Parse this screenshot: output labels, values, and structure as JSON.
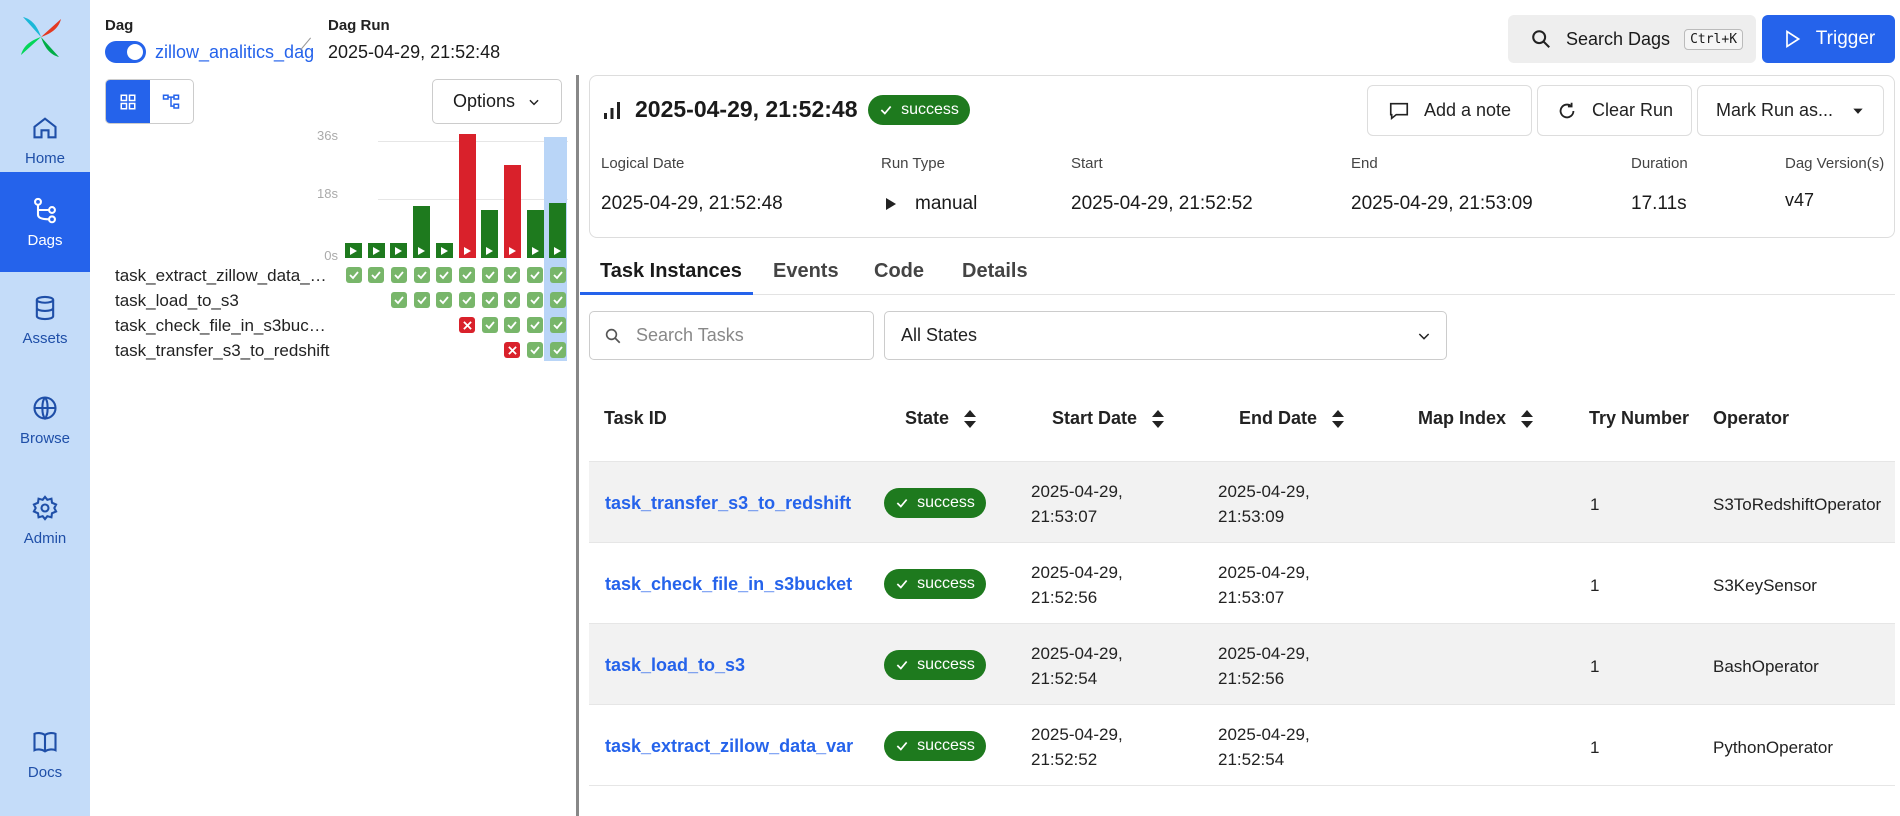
{
  "sidebar": {
    "items": [
      {
        "label": "Home",
        "icon": "home-icon"
      },
      {
        "label": "Dags",
        "icon": "dags-icon"
      },
      {
        "label": "Assets",
        "icon": "database-icon"
      },
      {
        "label": "Browse",
        "icon": "globe-icon"
      },
      {
        "label": "Admin",
        "icon": "gear-icon"
      },
      {
        "label": "Docs",
        "icon": "book-icon"
      }
    ],
    "active": "Dags"
  },
  "header": {
    "dag_label": "Dag",
    "dag_name": "zillow_analitics_dag",
    "run_label": "Dag Run",
    "run_value": "2025-04-29, 21:52:48",
    "search_label": "Search Dags",
    "search_shortcut": "Ctrl+K",
    "trigger_label": "Trigger"
  },
  "grid": {
    "options_label": "Options",
    "axis": [
      "36s",
      "18s",
      "0s"
    ],
    "durations_s": [
      4,
      4,
      4,
      15,
      4,
      36,
      14,
      27,
      14,
      16
    ],
    "run_states": [
      "success",
      "success",
      "success",
      "success",
      "success",
      "failed",
      "success",
      "failed",
      "success",
      "success"
    ],
    "tasks": [
      {
        "name": "task_extract_zillow_data_v...",
        "states": [
          "success",
          "success",
          "success",
          "success",
          "success",
          "success",
          "success",
          "success",
          "success",
          "success"
        ]
      },
      {
        "name": "task_load_to_s3",
        "states": [
          "none",
          "none",
          "success",
          "success",
          "success",
          "success",
          "success",
          "success",
          "success",
          "success"
        ]
      },
      {
        "name": "task_check_file_in_s3bucket",
        "states": [
          "none",
          "none",
          "none",
          "none",
          "none",
          "failed",
          "success",
          "success",
          "success",
          "success"
        ]
      },
      {
        "name": "task_transfer_s3_to_redshift",
        "states": [
          "none",
          "none",
          "none",
          "none",
          "none",
          "none",
          "none",
          "failed",
          "success",
          "success"
        ]
      }
    ]
  },
  "run": {
    "title": "2025-04-29, 21:52:48",
    "state": "success",
    "actions": {
      "note": "Add a note",
      "clear": "Clear Run",
      "mark": "Mark Run as..."
    },
    "meta": {
      "logical_date_label": "Logical Date",
      "logical_date": "2025-04-29, 21:52:48",
      "run_type_label": "Run Type",
      "run_type": "manual",
      "start_label": "Start",
      "start": "2025-04-29, 21:52:52",
      "end_label": "End",
      "end": "2025-04-29, 21:53:09",
      "duration_label": "Duration",
      "duration": "17.11s",
      "version_label": "Dag Version(s)",
      "version": "v47"
    }
  },
  "tabs": [
    "Task Instances",
    "Events",
    "Code",
    "Details"
  ],
  "filters": {
    "search_placeholder": "Search Tasks",
    "state_value": "All States"
  },
  "table": {
    "headers": {
      "task_id": "Task ID",
      "state": "State",
      "start": "Start Date",
      "end": "End Date",
      "map_index": "Map Index",
      "try": "Try Number",
      "operator": "Operator"
    },
    "rows": [
      {
        "task_id": "task_transfer_s3_to_redshift",
        "state": "success",
        "start_d": "2025-04-29,",
        "start_t": "21:53:07",
        "end_d": "2025-04-29,",
        "end_t": "21:53:09",
        "try": "1",
        "operator": "S3ToRedshiftOperator"
      },
      {
        "task_id": "task_check_file_in_s3bucket",
        "state": "success",
        "start_d": "2025-04-29,",
        "start_t": "21:52:56",
        "end_d": "2025-04-29,",
        "end_t": "21:53:07",
        "try": "1",
        "operator": "S3KeySensor"
      },
      {
        "task_id": "task_load_to_s3",
        "state": "success",
        "start_d": "2025-04-29,",
        "start_t": "21:52:54",
        "end_d": "2025-04-29,",
        "end_t": "21:52:56",
        "try": "1",
        "operator": "BashOperator"
      },
      {
        "task_id": "task_extract_zillow_data_var",
        "state": "success",
        "start_d": "2025-04-29,",
        "start_t": "21:52:52",
        "end_d": "2025-04-29,",
        "end_t": "21:52:54",
        "try": "1",
        "operator": "PythonOperator"
      }
    ]
  },
  "colors": {
    "accent": "#2563eb",
    "success": "#1e7a1e",
    "failed": "#d9212b",
    "sidebar": "#c4dcf9"
  }
}
